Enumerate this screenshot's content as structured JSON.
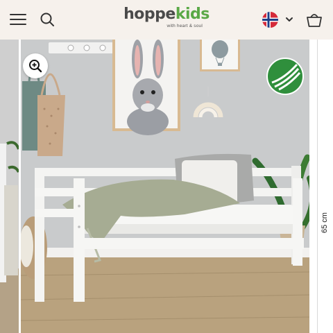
{
  "header": {
    "logo_text_main": "hoppe",
    "logo_text_accent": "kids",
    "logo_tagline": "with heart & soul",
    "icons": {
      "menu": "hamburger-menu-icon",
      "search": "search-icon",
      "language": "norway-flag-icon",
      "dropdown": "chevron-down-icon",
      "cart": "basket-icon"
    }
  },
  "gallery": {
    "dimension_label": "65 cm",
    "zoom_icon": "zoom-in-icon"
  },
  "colors": {
    "header_bg": "#f6f1ec",
    "brand_green": "#5aa846",
    "wall": "#c9cbcc",
    "floor": "#b9a27e",
    "bed_white": "#f4f4f2"
  }
}
